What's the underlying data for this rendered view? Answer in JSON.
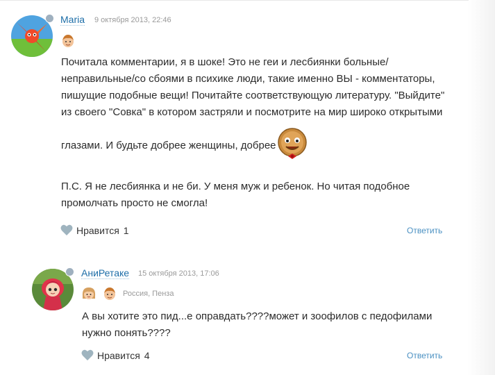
{
  "comments": [
    {
      "author": "Maria",
      "date": "9 октября 2013, 22:46",
      "text_lines": [
        "Почитала комментарии, я в шоке! Это не геи и лесбиянки больные/",
        "неправильные/со сбоями в психике люди, такие именно ВЫ - комментаторы,",
        "пишущие подобные вещи! Почитайте соответствующую литературу. \"Выйдите\"",
        "из своего \"Совка\" в котором застряли и посмотрите на мир широко открытыми",
        "глазами. И будьте добрее женщины, добрее",
        "П.С. Я не лесбиянка и не би. У меня муж и ребенок. Но читая подобное",
        "промолчать просто не смогла!"
      ],
      "like_label": "Нравится",
      "like_count": "1",
      "reply_label": "Ответить"
    },
    {
      "author": "АниРетаке",
      "date": "15 октября 2013, 17:06",
      "location": "Россия, Пенза",
      "text_lines": [
        "А вы хотите это пид...е оправдать????может и зоофилов с педофилами",
        "нужно понять????"
      ],
      "like_label": "Нравится",
      "like_count": "4",
      "reply_label": "Ответить"
    }
  ],
  "colors": {
    "author_link": "#1d6ea8",
    "reply_link": "#4a90c2",
    "heart": "#9fb4bf"
  },
  "icons": {
    "status": "status-clock-icon",
    "like": "heart-icon",
    "badge_boy": "boy-badge-icon",
    "badge_girl": "girl-badge-icon",
    "smiley": "gingerbread-smiley-icon"
  }
}
